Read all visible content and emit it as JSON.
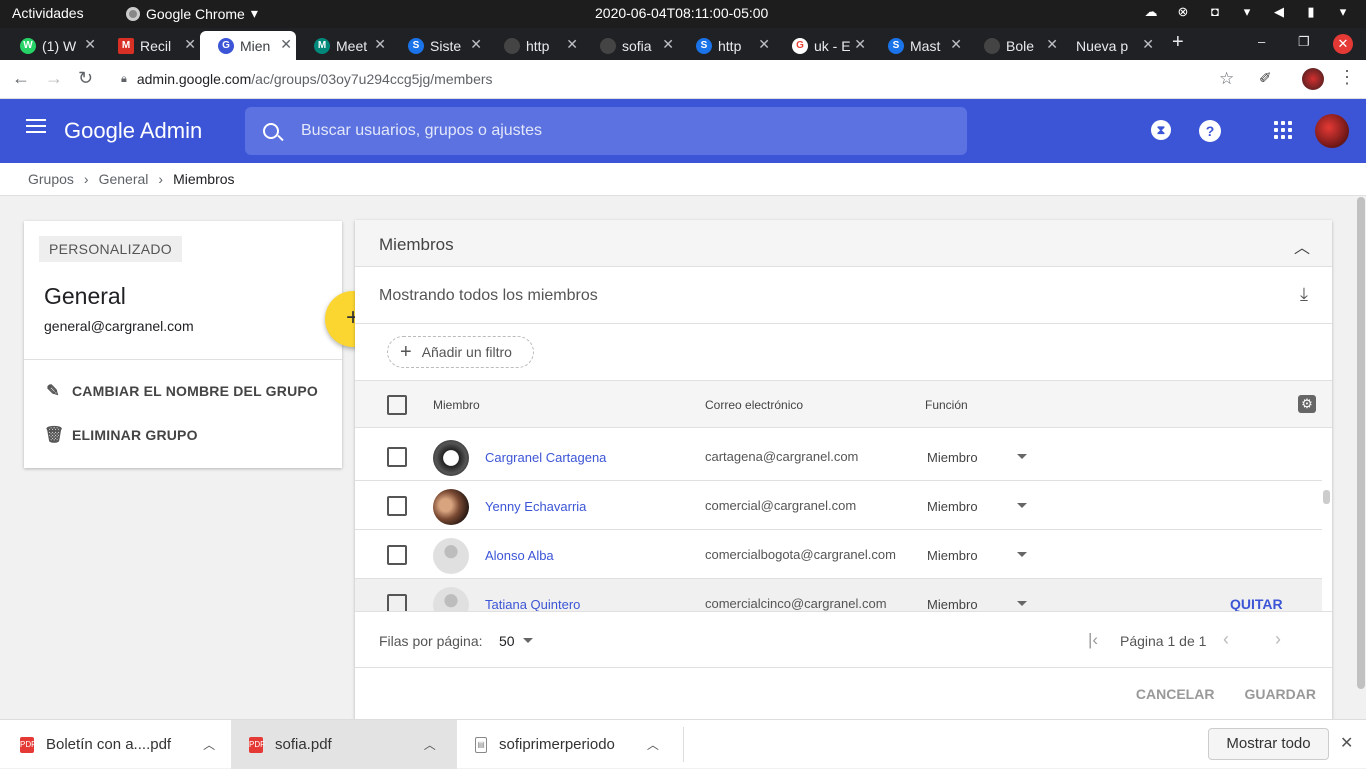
{
  "os": {
    "activities": "Actividades",
    "app_name": "Google Chrome",
    "clock": "2020-06-04T08:11:00-05:00"
  },
  "tabs": [
    {
      "label": "(1) W",
      "color": "#25d366",
      "glyph": "W"
    },
    {
      "label": "Recil",
      "color": "#d93025",
      "glyph": "M"
    },
    {
      "label": "Mien",
      "color": "#3c55d6",
      "glyph": "G",
      "active": true
    },
    {
      "label": "Meet",
      "color": "#00897b",
      "glyph": "M"
    },
    {
      "label": "Siste",
      "color": "#1a73e8",
      "glyph": "S"
    },
    {
      "label": "http",
      "color": "#5f6368",
      "glyph": ""
    },
    {
      "label": "sofia",
      "color": "#5f6368",
      "glyph": ""
    },
    {
      "label": "http",
      "color": "#1a73e8",
      "glyph": "S"
    },
    {
      "label": "uk - E",
      "color": "#ea4335",
      "glyph": "G"
    },
    {
      "label": "Mast",
      "color": "#1a73e8",
      "glyph": "S"
    },
    {
      "label": "Bole",
      "color": "#5f6368",
      "glyph": ""
    },
    {
      "label": "Nueva p",
      "color": "",
      "glyph": ""
    }
  ],
  "omnibox": {
    "host": "admin.google.com",
    "path": "/ac/groups/03oy7u294ccg5jg/members"
  },
  "header": {
    "brand": "Google Admin",
    "search_placeholder": "Buscar usuarios, grupos o ajustes"
  },
  "breadcrumb": [
    "Grupos",
    "General",
    "Miembros"
  ],
  "group": {
    "badge": "PERSONALIZADO",
    "name": "General",
    "email": "general@cargranel.com",
    "rename_label": "CAMBIAR EL NOMBRE DEL GRUPO",
    "delete_label": "ELIMINAR GRUPO"
  },
  "members": {
    "title": "Miembros",
    "showing": "Mostrando todos los miembros",
    "add_filter": "Añadir un filtro",
    "columns": {
      "member": "Miembro",
      "email": "Correo electrónico",
      "role": "Función"
    },
    "rows": [
      {
        "name": "Cargranel Cartagena",
        "email": "cartagena@cargranel.com",
        "role": "Miembro",
        "avatar": "logo"
      },
      {
        "name": "Yenny Echavarria",
        "email": "comercial@cargranel.com",
        "role": "Miembro",
        "avatar": "photo"
      },
      {
        "name": "Alonso Alba",
        "email": "comercialbogota@cargranel.com",
        "role": "Miembro",
        "avatar": "default"
      },
      {
        "name": "Tatiana Quintero",
        "email": "comercialcinco@cargranel.com",
        "role": "Miembro",
        "avatar": "default",
        "remove": "QUITAR"
      }
    ],
    "rows_per_page_label": "Filas por página:",
    "rows_per_page": "50",
    "page_info": "Página 1 de 1",
    "cancel": "CANCELAR",
    "save": "GUARDAR"
  },
  "downloads": {
    "items": [
      "Boletín con a....pdf",
      "sofia.pdf",
      "sofiprimerperiodo"
    ],
    "show_all": "Mostrar todo"
  },
  "colors": {
    "accent": "#3c55d6",
    "fab": "#fbd630"
  }
}
